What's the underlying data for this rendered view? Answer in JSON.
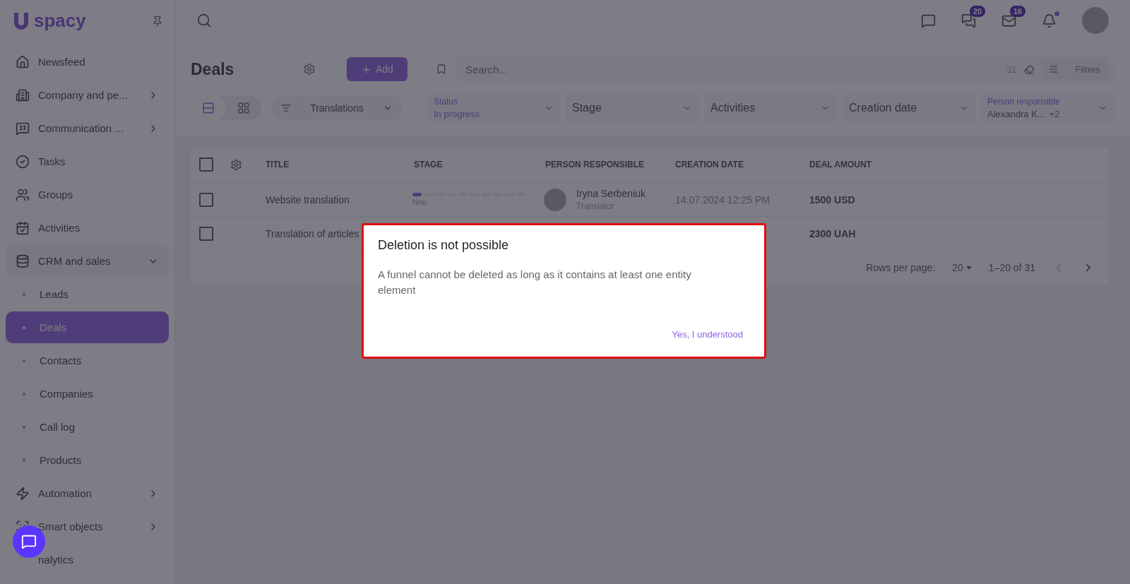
{
  "sidebar": {
    "logo": "spacy",
    "items": [
      {
        "label": "Newsfeed",
        "expandable": false,
        "selected": false
      },
      {
        "label": "Company and pe...",
        "expandable": true,
        "selected": false
      },
      {
        "label": "Communication ...",
        "expandable": true,
        "selected": false
      },
      {
        "label": "Tasks",
        "expandable": false,
        "selected": false
      },
      {
        "label": "Groups",
        "expandable": false,
        "selected": false
      },
      {
        "label": "Activities",
        "expandable": false,
        "selected": false
      },
      {
        "label": "CRM and sales",
        "expandable": true,
        "expanded": true,
        "selected": false,
        "children": [
          {
            "label": "Leads",
            "selected": false
          },
          {
            "label": "Deals",
            "selected": true
          },
          {
            "label": "Contacts",
            "selected": false
          },
          {
            "label": "Companies",
            "selected": false
          },
          {
            "label": "Call log",
            "selected": false
          },
          {
            "label": "Products",
            "selected": false
          }
        ]
      },
      {
        "label": "Automation",
        "expandable": true,
        "selected": false
      },
      {
        "label": "Smart objects",
        "expandable": true,
        "selected": false
      },
      {
        "label": "nalytics",
        "expandable": false,
        "selected": false
      }
    ]
  },
  "topbar": {
    "chats_count": "20",
    "mail_count": "16",
    "notifications_dot": true
  },
  "page": {
    "title": "Deals",
    "add_button": "Add",
    "search": {
      "placeholder": "Search...",
      "count": "31",
      "filters": "Filters"
    },
    "view": [
      {
        "kind": "list",
        "selected": true
      },
      {
        "kind": "grid",
        "selected": false
      }
    ],
    "pipeline": "Translations",
    "filters": [
      {
        "label": "Status",
        "value": "In progress"
      },
      {
        "label": "Stage"
      },
      {
        "label": "Activities"
      },
      {
        "label": "Creation date"
      },
      {
        "label": "Person responsible",
        "value": "Alexandra K...",
        "extra": "+2"
      }
    ]
  },
  "table": {
    "all_checked": false,
    "columns": [
      "TITLE",
      "STAGE",
      "PERSON RESPONSIBLE",
      "CREATION DATE",
      "DEAL AMOUNT"
    ],
    "rows": [
      {
        "checked": false,
        "title": "Website translation",
        "stage": {
          "label": "New",
          "level": 0.1
        },
        "person": {
          "name": "Iryna Serbeniuk",
          "role": "Translator"
        },
        "date": "14.07.2024 12:25 PM",
        "amount": "1500 USD"
      },
      {
        "checked": false,
        "title": "Translation of articles",
        "amount": "2300 UAH"
      }
    ],
    "footer": {
      "rows_label": "Rows per page:",
      "rows_value": "20",
      "range": "1–20 of 31"
    }
  },
  "dialog": {
    "title": "Deletion is not possible",
    "message": "A funnel cannot be deleted as long as it contains at least one entity element",
    "button": "Yes, I understood"
  }
}
